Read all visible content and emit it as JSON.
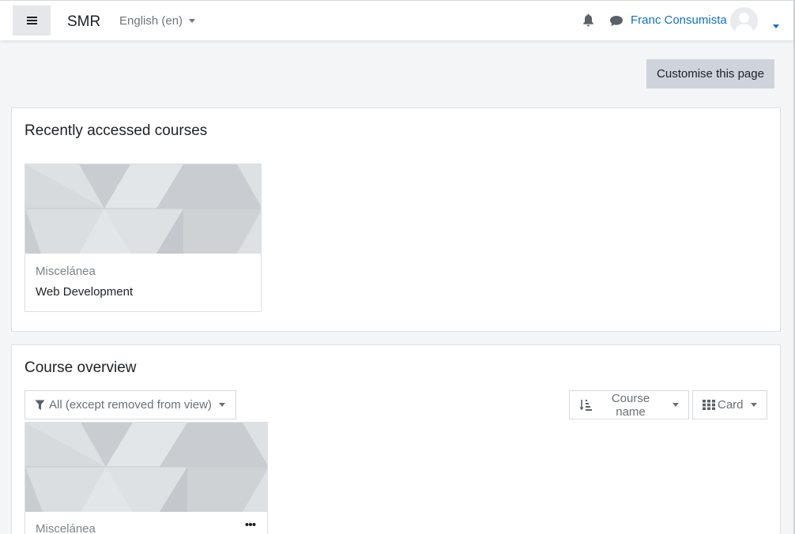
{
  "navbar": {
    "menu_icon": "hamburger-icon",
    "brand": "SMR",
    "language": "English (en)",
    "notification_icon": "bell-icon",
    "messages_icon": "chat-bubble-icon",
    "username": "Franc Consumista",
    "avatar_icon": "user-avatar-icon"
  },
  "page": {
    "customise_label": "Customise this page"
  },
  "recent": {
    "title": "Recently accessed courses",
    "courses": [
      {
        "category": "Miscelánea",
        "name": "Web Development"
      }
    ]
  },
  "overview": {
    "title": "Course overview",
    "filter_label": "All (except removed from view)",
    "filter_icon": "funnel-icon",
    "sort_label": "Course name",
    "sort_icon": "sort-alpha-icon",
    "view_label": "Card",
    "view_icon": "grid-icon",
    "courses": [
      {
        "category": "Miscelánea",
        "menu_icon": "ellipsis-icon"
      }
    ]
  },
  "colors": {
    "link": "#1070c8",
    "button_bg": "#ced4da",
    "page_bg": "#f4f5f7"
  }
}
